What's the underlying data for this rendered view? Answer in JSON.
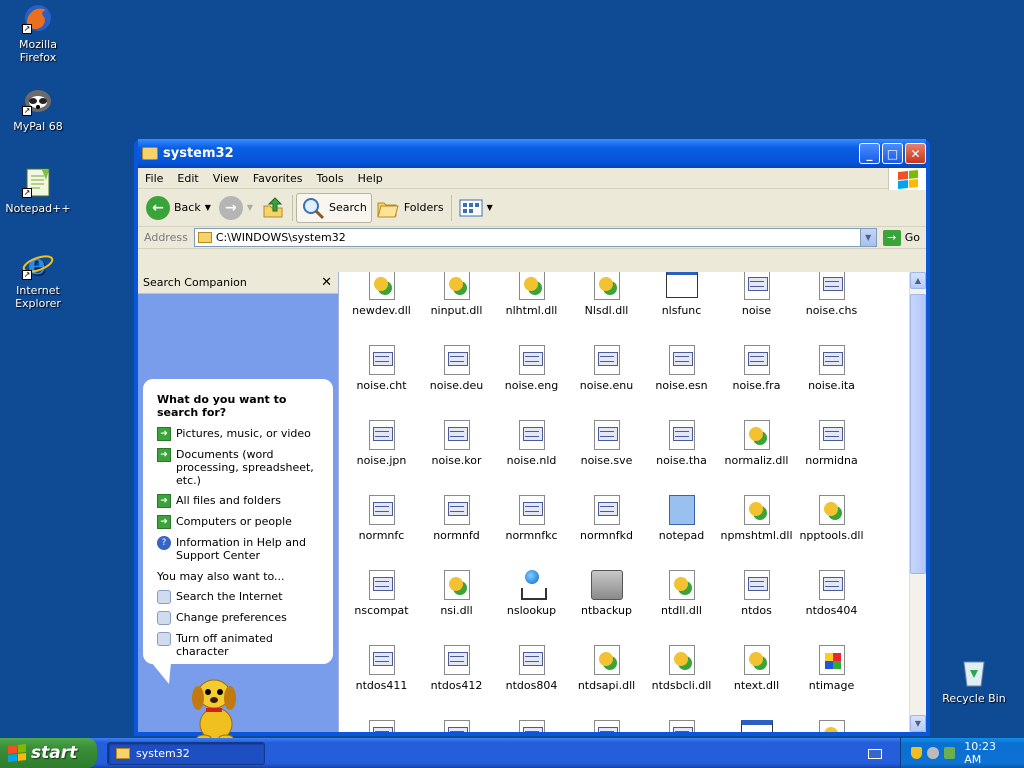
{
  "desktop": {
    "icons": [
      {
        "label": "Mozilla Firefox",
        "icon": "firefox-icon"
      },
      {
        "label": "MyPal 68",
        "icon": "mypal-icon"
      },
      {
        "label": "Notepad++",
        "icon": "notepadpp-icon"
      },
      {
        "label": "Internet Explorer",
        "icon": "ie-icon"
      },
      {
        "label": "Recycle Bin",
        "icon": "recycle-bin-icon"
      }
    ]
  },
  "window": {
    "title": "system32",
    "menu": [
      "File",
      "Edit",
      "View",
      "Favorites",
      "Tools",
      "Help"
    ],
    "toolbar": {
      "back": "Back",
      "search": "Search",
      "folders": "Folders"
    },
    "address": {
      "label": "Address",
      "value": "C:\\WINDOWS\\system32",
      "go": "Go"
    }
  },
  "companion": {
    "title": "Search Companion",
    "question": "What do you want to search for?",
    "options": [
      "Pictures, music, or video",
      "Documents (word processing, spreadsheet, etc.)",
      "All files and folders",
      "Computers or people",
      "Information in Help and Support Center"
    ],
    "also_label": "You may also want to...",
    "also": [
      "Search the Internet",
      "Change preferences",
      "Turn off animated character"
    ]
  },
  "files": [
    {
      "name": "newdev.dll",
      "type": "dll"
    },
    {
      "name": "ninput.dll",
      "type": "dll"
    },
    {
      "name": "nlhtml.dll",
      "type": "dll"
    },
    {
      "name": "Nlsdl.dll",
      "type": "dll"
    },
    {
      "name": "nlsfunc",
      "type": "app"
    },
    {
      "name": "noise",
      "type": "doc"
    },
    {
      "name": "noise.chs",
      "type": "doc"
    },
    {
      "name": "noise.cht",
      "type": "doc"
    },
    {
      "name": "noise.deu",
      "type": "doc"
    },
    {
      "name": "noise.eng",
      "type": "doc"
    },
    {
      "name": "noise.enu",
      "type": "doc"
    },
    {
      "name": "noise.esn",
      "type": "doc"
    },
    {
      "name": "noise.fra",
      "type": "doc"
    },
    {
      "name": "noise.ita",
      "type": "doc"
    },
    {
      "name": "noise.jpn",
      "type": "doc"
    },
    {
      "name": "noise.kor",
      "type": "doc"
    },
    {
      "name": "noise.nld",
      "type": "doc"
    },
    {
      "name": "noise.sve",
      "type": "doc"
    },
    {
      "name": "noise.tha",
      "type": "doc"
    },
    {
      "name": "normaliz.dll",
      "type": "dll"
    },
    {
      "name": "normidna",
      "type": "doc"
    },
    {
      "name": "normnfc",
      "type": "doc"
    },
    {
      "name": "normnfd",
      "type": "doc"
    },
    {
      "name": "normnfkc",
      "type": "doc"
    },
    {
      "name": "normnfkd",
      "type": "doc"
    },
    {
      "name": "notepad",
      "type": "notepad"
    },
    {
      "name": "npmshtml.dll",
      "type": "dll"
    },
    {
      "name": "npptools.dll",
      "type": "dll"
    },
    {
      "name": "nscompat",
      "type": "doc"
    },
    {
      "name": "nsi.dll",
      "type": "dll"
    },
    {
      "name": "nslookup",
      "type": "globe"
    },
    {
      "name": "ntbackup",
      "type": "backup"
    },
    {
      "name": "ntdll.dll",
      "type": "dll"
    },
    {
      "name": "ntdos",
      "type": "doc"
    },
    {
      "name": "ntdos404",
      "type": "doc"
    },
    {
      "name": "ntdos411",
      "type": "doc"
    },
    {
      "name": "ntdos412",
      "type": "doc"
    },
    {
      "name": "ntdos804",
      "type": "doc"
    },
    {
      "name": "ntdsapi.dll",
      "type": "dll"
    },
    {
      "name": "ntdsbcli.dll",
      "type": "dll"
    },
    {
      "name": "ntext.dll",
      "type": "dll"
    },
    {
      "name": "ntimage",
      "type": "img"
    },
    {
      "name": "",
      "type": "doc"
    },
    {
      "name": "",
      "type": "doc"
    },
    {
      "name": "",
      "type": "doc"
    },
    {
      "name": "",
      "type": "doc"
    },
    {
      "name": "",
      "type": "doc"
    },
    {
      "name": "",
      "type": "app"
    },
    {
      "name": "",
      "type": "dll"
    }
  ],
  "taskbar": {
    "start": "start",
    "task": "system32",
    "clock": "10:23 AM"
  }
}
